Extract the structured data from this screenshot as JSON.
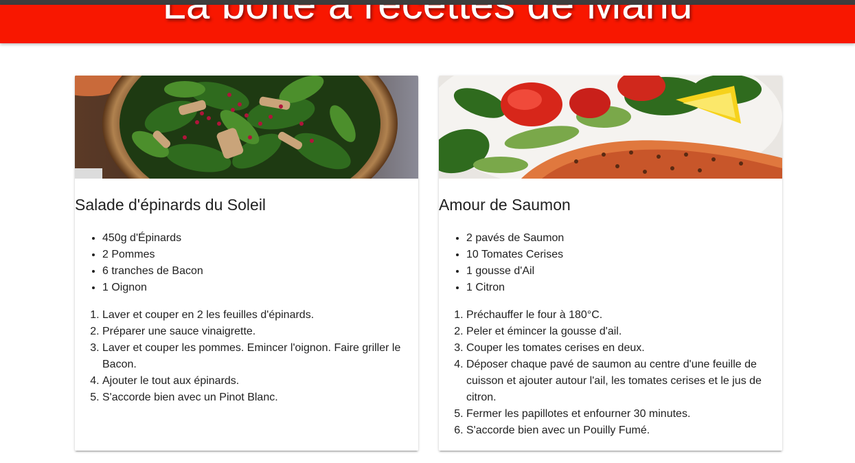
{
  "header": {
    "title": "La boîte à recettes de Manu"
  },
  "recipes": [
    {
      "title": "Salade d'épinards du Soleil",
      "image": "spinach-salad-photo",
      "ingredients": [
        "450g d'Épinards",
        "2 Pommes",
        "6 tranches de Bacon",
        "1 Oignon"
      ],
      "steps": [
        "Laver et couper en 2 les feuilles d'épinards.",
        "Préparer une sauce vinaigrette.",
        "Laver et couper les pommes. Emincer l'oignon. Faire griller le Bacon.",
        "Ajouter le tout aux épinards.",
        "S'accorde bien avec un Pinot Blanc."
      ]
    },
    {
      "title": "Amour de Saumon",
      "image": "grilled-salmon-photo",
      "ingredients": [
        "2 pavés de Saumon",
        "10 Tomates Cerises",
        "1 gousse d'Ail",
        "1 Citron"
      ],
      "steps": [
        "Préchauffer le four à 180°C.",
        "Peler et émincer la gousse d'ail.",
        "Couper les tomates cerises en deux.",
        "Déposer chaque pavé de saumon au centre d'une feuille de cuisson et ajouter autour l'ail, les tomates cerises et le jus de citron.",
        "Fermer les papillotes et enfourner 30 minutes.",
        "S'accorde bien avec un Pouilly Fumé."
      ]
    }
  ],
  "colors": {
    "header": "#f81700",
    "text": "#212121"
  }
}
